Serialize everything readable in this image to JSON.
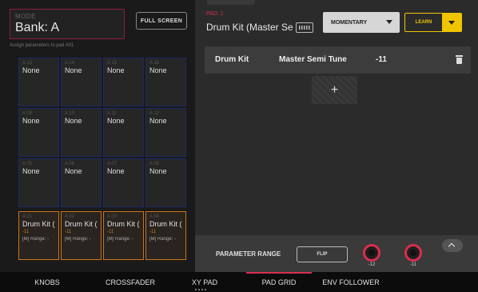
{
  "left": {
    "mode_label": "MODE",
    "mode_value": "Bank: A",
    "full_screen_label": "FULL SCREEN",
    "assign_hint": "Assign parameters to pad A01"
  },
  "pads": [
    {
      "num": "A 13",
      "name": "None"
    },
    {
      "num": "A 14",
      "name": "None"
    },
    {
      "num": "A 15",
      "name": "None"
    },
    {
      "num": "A 16",
      "name": "None"
    },
    {
      "num": "A 09",
      "name": "None"
    },
    {
      "num": "A 10",
      "name": "None"
    },
    {
      "num": "A 11",
      "name": "None"
    },
    {
      "num": "A 12",
      "name": "None"
    },
    {
      "num": "A 05",
      "name": "None"
    },
    {
      "num": "A 06",
      "name": "None"
    },
    {
      "num": "A 07",
      "name": "None"
    },
    {
      "num": "A 08",
      "name": "None"
    },
    {
      "num": "A 01",
      "name": "Drum Kit (",
      "value": "-11",
      "range": "[M] Range: -"
    },
    {
      "num": "A 02",
      "name": "Drum Kit (",
      "value": "-11",
      "range": "[M] Range: -"
    },
    {
      "num": "A 03",
      "name": "Drum Kit (",
      "value": "-11",
      "range": "[M] Range: -"
    },
    {
      "num": "A 04",
      "name": "Drum Kit (",
      "value": "-11",
      "range": "[M] Range: -"
    }
  ],
  "right": {
    "pad_id": "PAD: 1",
    "pad_title": "Drum Kit (Master Se",
    "mode_dropdown": "MOMENTARY",
    "learn_label": "LEARN",
    "param_row": {
      "target": "Drum Kit",
      "parameter": "Master Semi Tune",
      "value": "-11"
    },
    "add_symbol": "+",
    "range_label": "PARAMETER RANGE",
    "flip_label": "FLIP",
    "knob_min": "-12",
    "knob_max": "-11"
  },
  "nav": {
    "items": [
      "KNOBS",
      "CROSSFADER",
      "XY PAD",
      "PAD GRID",
      "ENV FOLLOWER"
    ],
    "active": "PAD GRID"
  },
  "colors": {
    "accent_red": "#d92d4f",
    "learn_yellow": "#f0c400",
    "active_pad_orange": "#c8741a",
    "pad_border_blue": "#1c2a66"
  }
}
